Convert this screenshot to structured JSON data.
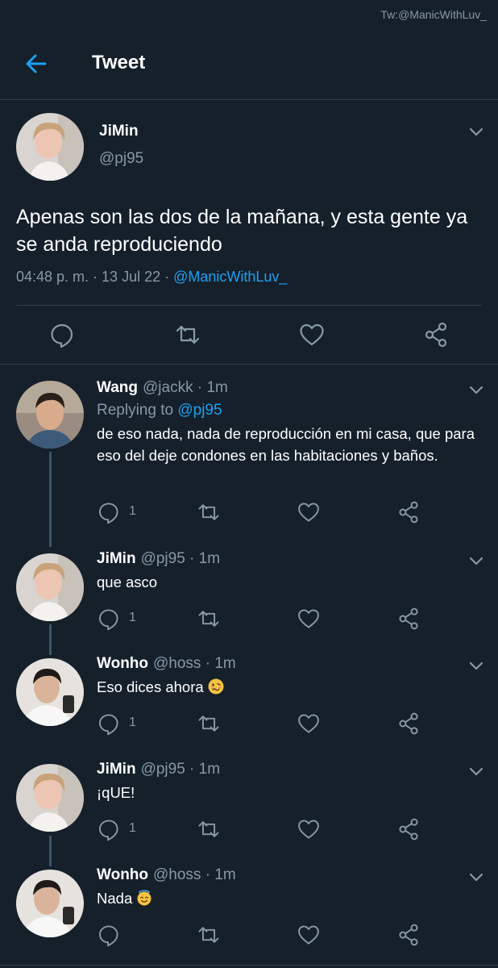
{
  "watermark": "Tw:@ManicWithLuv_",
  "header": {
    "title": "Tweet"
  },
  "main_tweet": {
    "name": "JiMin",
    "handle": "@pj95",
    "text": "Apenas son las dos de la mañana, y esta gente ya se anda reproduciendo",
    "time": "04:48 p. m. · 13 Jul 22 · ",
    "source": "@ManicWithLuv_"
  },
  "replies": [
    {
      "name": "Wang",
      "handle": "@jackk · 1m",
      "replying_label": "Replying to ",
      "replying_to": "@pj95",
      "text": "de eso nada, nada de reproducción en mi casa, que para eso del deje condones en las habitaciones y baños.",
      "reply_count": "1"
    },
    {
      "name": "JiMin",
      "handle": "@pj95 · 1m",
      "text": "que asco",
      "reply_count": "1"
    },
    {
      "name": "Wonho",
      "handle": "@hoss · 1m",
      "text": "Eso dices ahora",
      "emoji": "woozy-face",
      "reply_count": "1"
    },
    {
      "name": "JiMin",
      "handle": "@pj95 · 1m",
      "text": "¡qUE!",
      "reply_count": "1"
    },
    {
      "name": "Wonho",
      "handle": "@hoss · 1m",
      "text": "Nada",
      "emoji": "smiling-face-with-halo",
      "reply_count": ""
    }
  ],
  "colors": {
    "background": "#15202b",
    "accent": "#1da1f2",
    "muted": "#8899a6",
    "divider": "#2f3f4f"
  }
}
